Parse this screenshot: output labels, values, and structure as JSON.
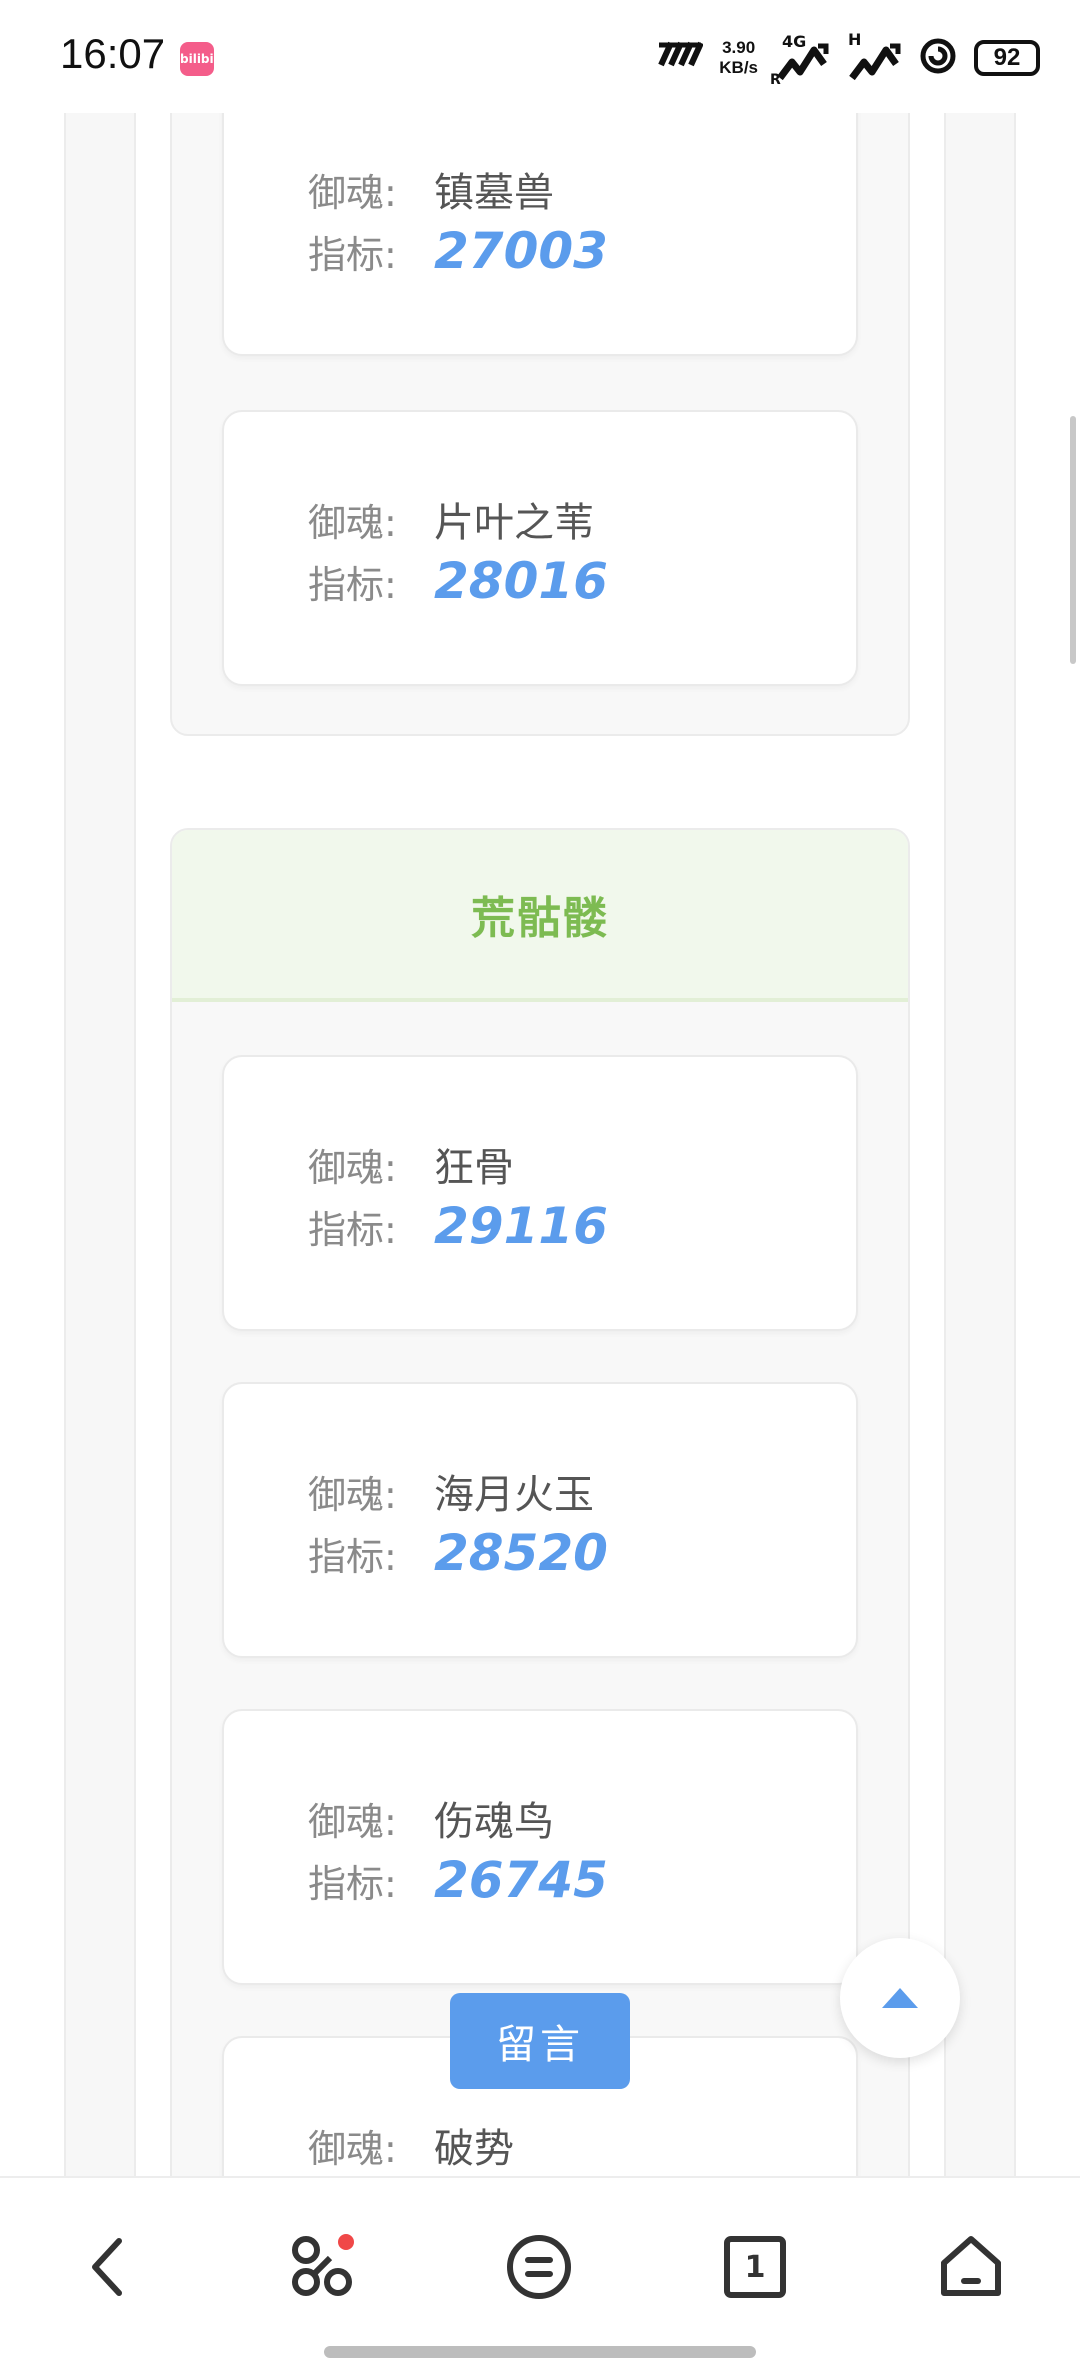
{
  "status_bar": {
    "time": "16:07",
    "app_badge": "bilibili",
    "speed_top": "3.90",
    "speed_bottom": "KB/s",
    "net1_tag": "4G",
    "net1_sub": "R",
    "net2_tag": "H",
    "battery": "92"
  },
  "labels": {
    "soul": "御魂:",
    "metric": "指标:"
  },
  "cards_top": [
    {
      "soul": "镇墓兽",
      "metric": "27003"
    },
    {
      "soul": "片叶之苇",
      "metric": "28016"
    }
  ],
  "section2": {
    "title": "荒骷髅",
    "cards": [
      {
        "soul": "狂骨",
        "metric": "29116"
      },
      {
        "soul": "海月火玉",
        "metric": "28520"
      },
      {
        "soul": "伤魂鸟",
        "metric": "26745"
      },
      {
        "soul": "破势"
      }
    ]
  },
  "actions": {
    "comment": "留言"
  },
  "nav": {
    "tabs_count": "1"
  },
  "colors": {
    "accent": "#5b9cec",
    "section_title": "#7dbb52",
    "section_head_bg": "#f1f8ec"
  }
}
